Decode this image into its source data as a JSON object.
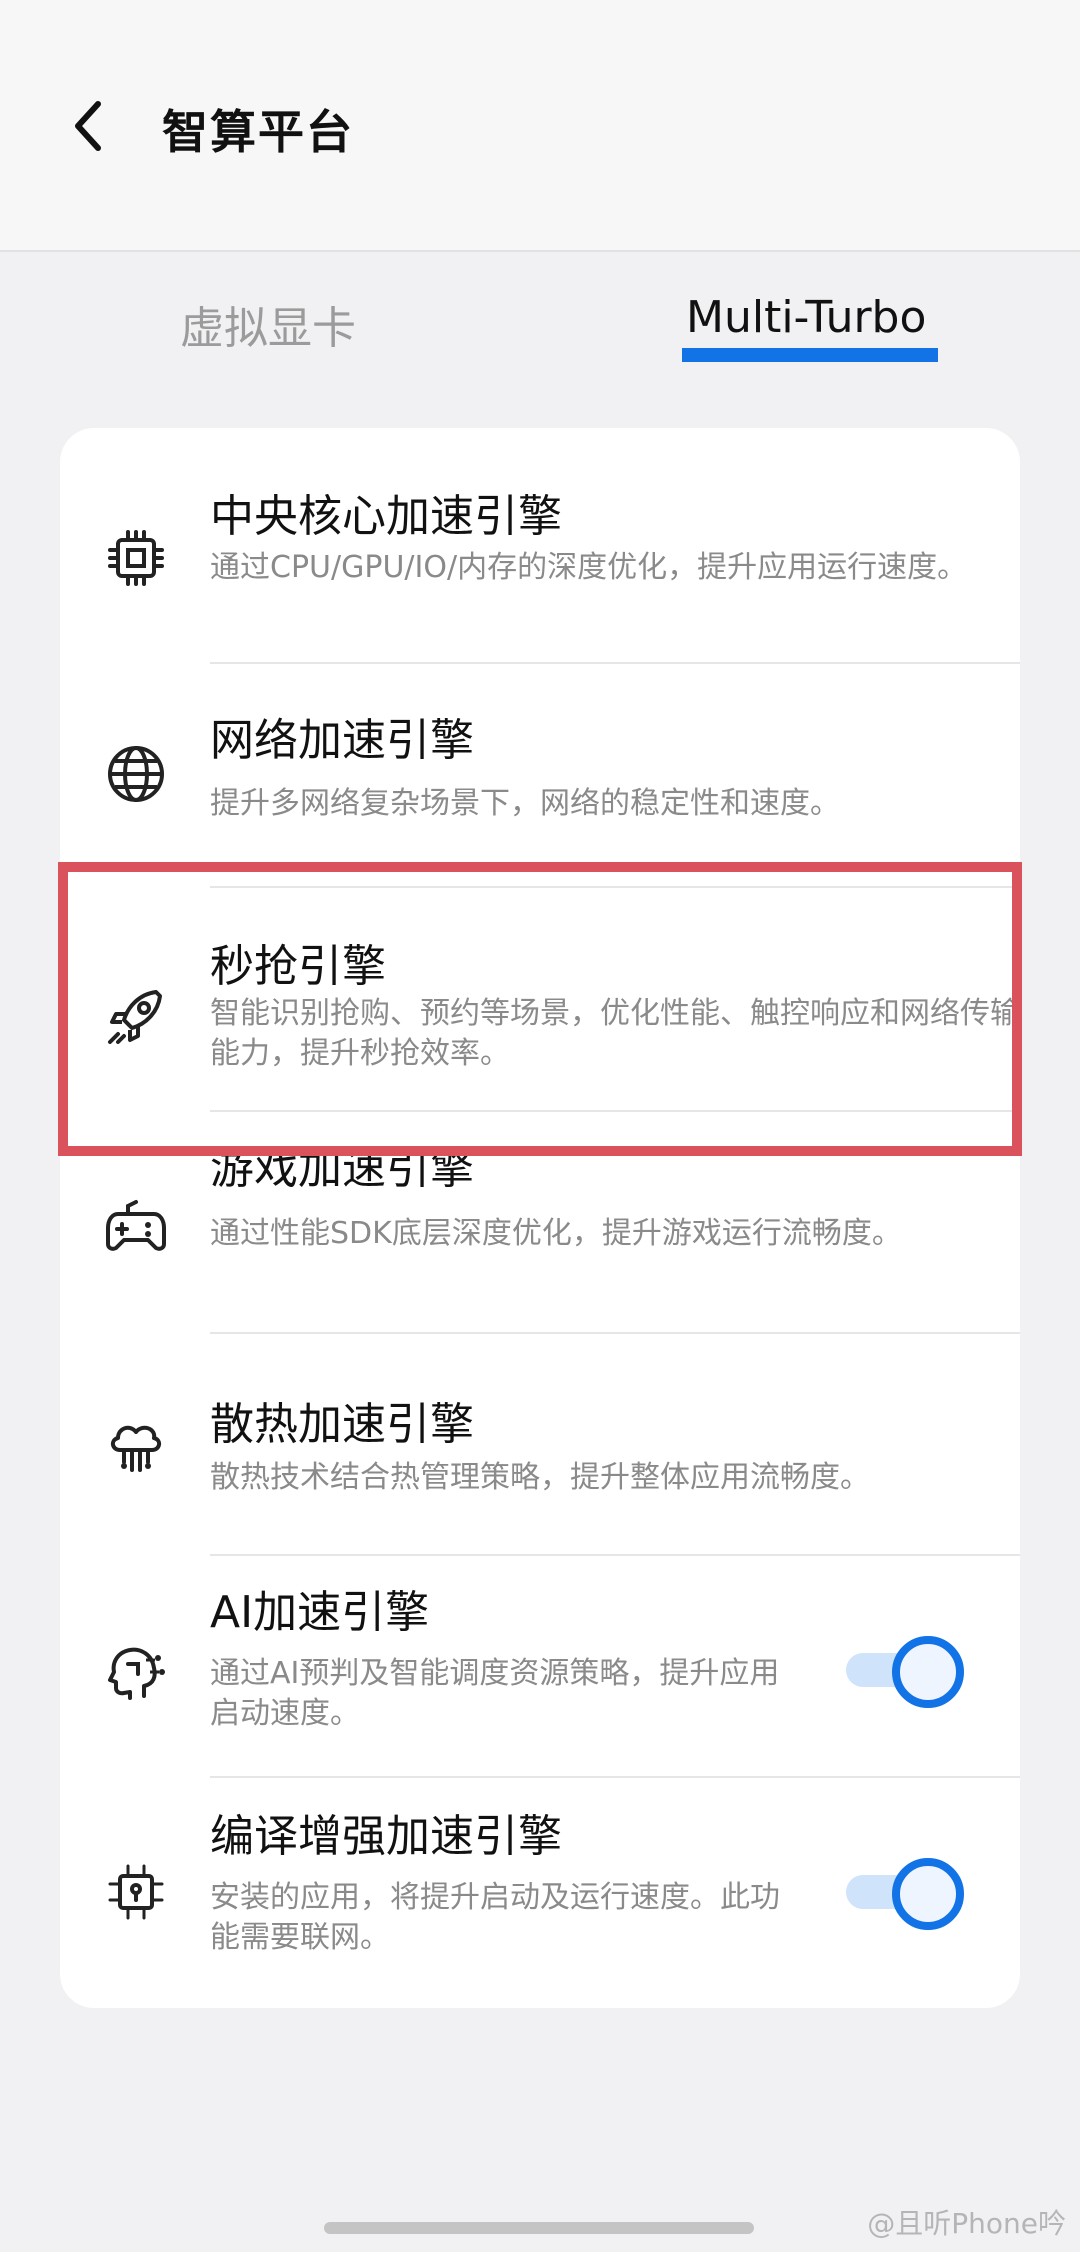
{
  "header": {
    "title": "智算平台",
    "back_icon": "chevron-left-icon"
  },
  "tabs": [
    {
      "label": "虚拟显卡",
      "selected": false
    },
    {
      "label": "Multi-Turbo",
      "selected": true
    }
  ],
  "colors": {
    "accent": "#1273e6",
    "highlight_box": "#d9525c",
    "toggle_track": "#cfe3fb"
  },
  "engines": [
    {
      "icon": "cpu-chip-icon",
      "title": "中央核心加速引擎",
      "desc": "通过CPU/GPU/IO/内存的深度优化，提升应用运行速度。"
    },
    {
      "icon": "globe-icon",
      "title": "网络加速引擎",
      "desc": "提升多网络复杂场景下，网络的稳定性和速度。"
    },
    {
      "icon": "rocket-icon",
      "title": "秒抢引擎",
      "desc": "智能识别抢购、预约等场景，优化性能、触控响应和网络传输能力，提升秒抢效率。"
    },
    {
      "icon": "gamepad-icon",
      "title": "游戏加速引擎",
      "desc": "通过性能SDK底层深度优化，提升游戏运行流畅度。"
    },
    {
      "icon": "cloud-cooling-icon",
      "title": "散热加速引擎",
      "desc": "散热技术结合热管理策略，提升整体应用流畅度。"
    },
    {
      "icon": "ai-head-icon",
      "title": "AI加速引擎",
      "desc": "通过AI预判及智能调度资源策略，提升应用启动速度。",
      "toggle_on": true
    },
    {
      "icon": "compile-chip-icon",
      "title": "编译增强加速引擎",
      "desc": "安装的应用，将提升启动及运行速度。此功能需要联网。",
      "toggle_on": true
    }
  ],
  "watermark": "@且听Phone吟"
}
